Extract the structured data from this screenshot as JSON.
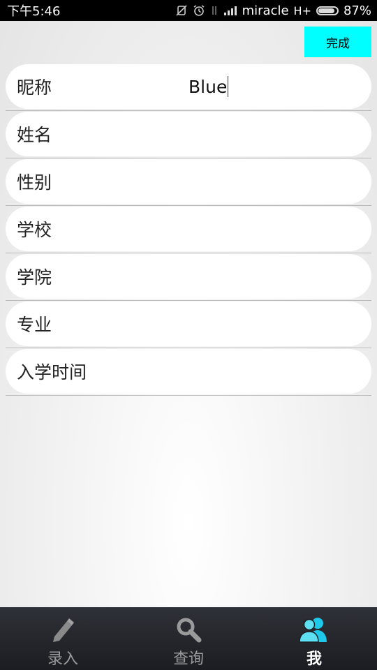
{
  "status_bar": {
    "time": "下午5:46",
    "carrier": "miracle",
    "network": "H+",
    "battery_percent": "87%",
    "battery_level": 0.87
  },
  "toolbar": {
    "done_label": "完成",
    "done_color": "#00ffff"
  },
  "form": {
    "rows": [
      {
        "label": "昵称",
        "value": "Blue"
      },
      {
        "label": "姓名",
        "value": ""
      },
      {
        "label": "性别",
        "value": ""
      },
      {
        "label": "学校",
        "value": ""
      },
      {
        "label": "学院",
        "value": ""
      },
      {
        "label": "专业",
        "value": ""
      },
      {
        "label": "入学时间",
        "value": ""
      }
    ]
  },
  "tabs": [
    {
      "label": "录入",
      "icon": "pencil-icon",
      "active": false
    },
    {
      "label": "查询",
      "icon": "search-icon",
      "active": false
    },
    {
      "label": "我",
      "icon": "users-icon",
      "active": true
    }
  ],
  "colors": {
    "accent": "#00ffff",
    "tab_active_icon": "#1ec8e8",
    "tab_inactive": "#9b9b9b"
  }
}
